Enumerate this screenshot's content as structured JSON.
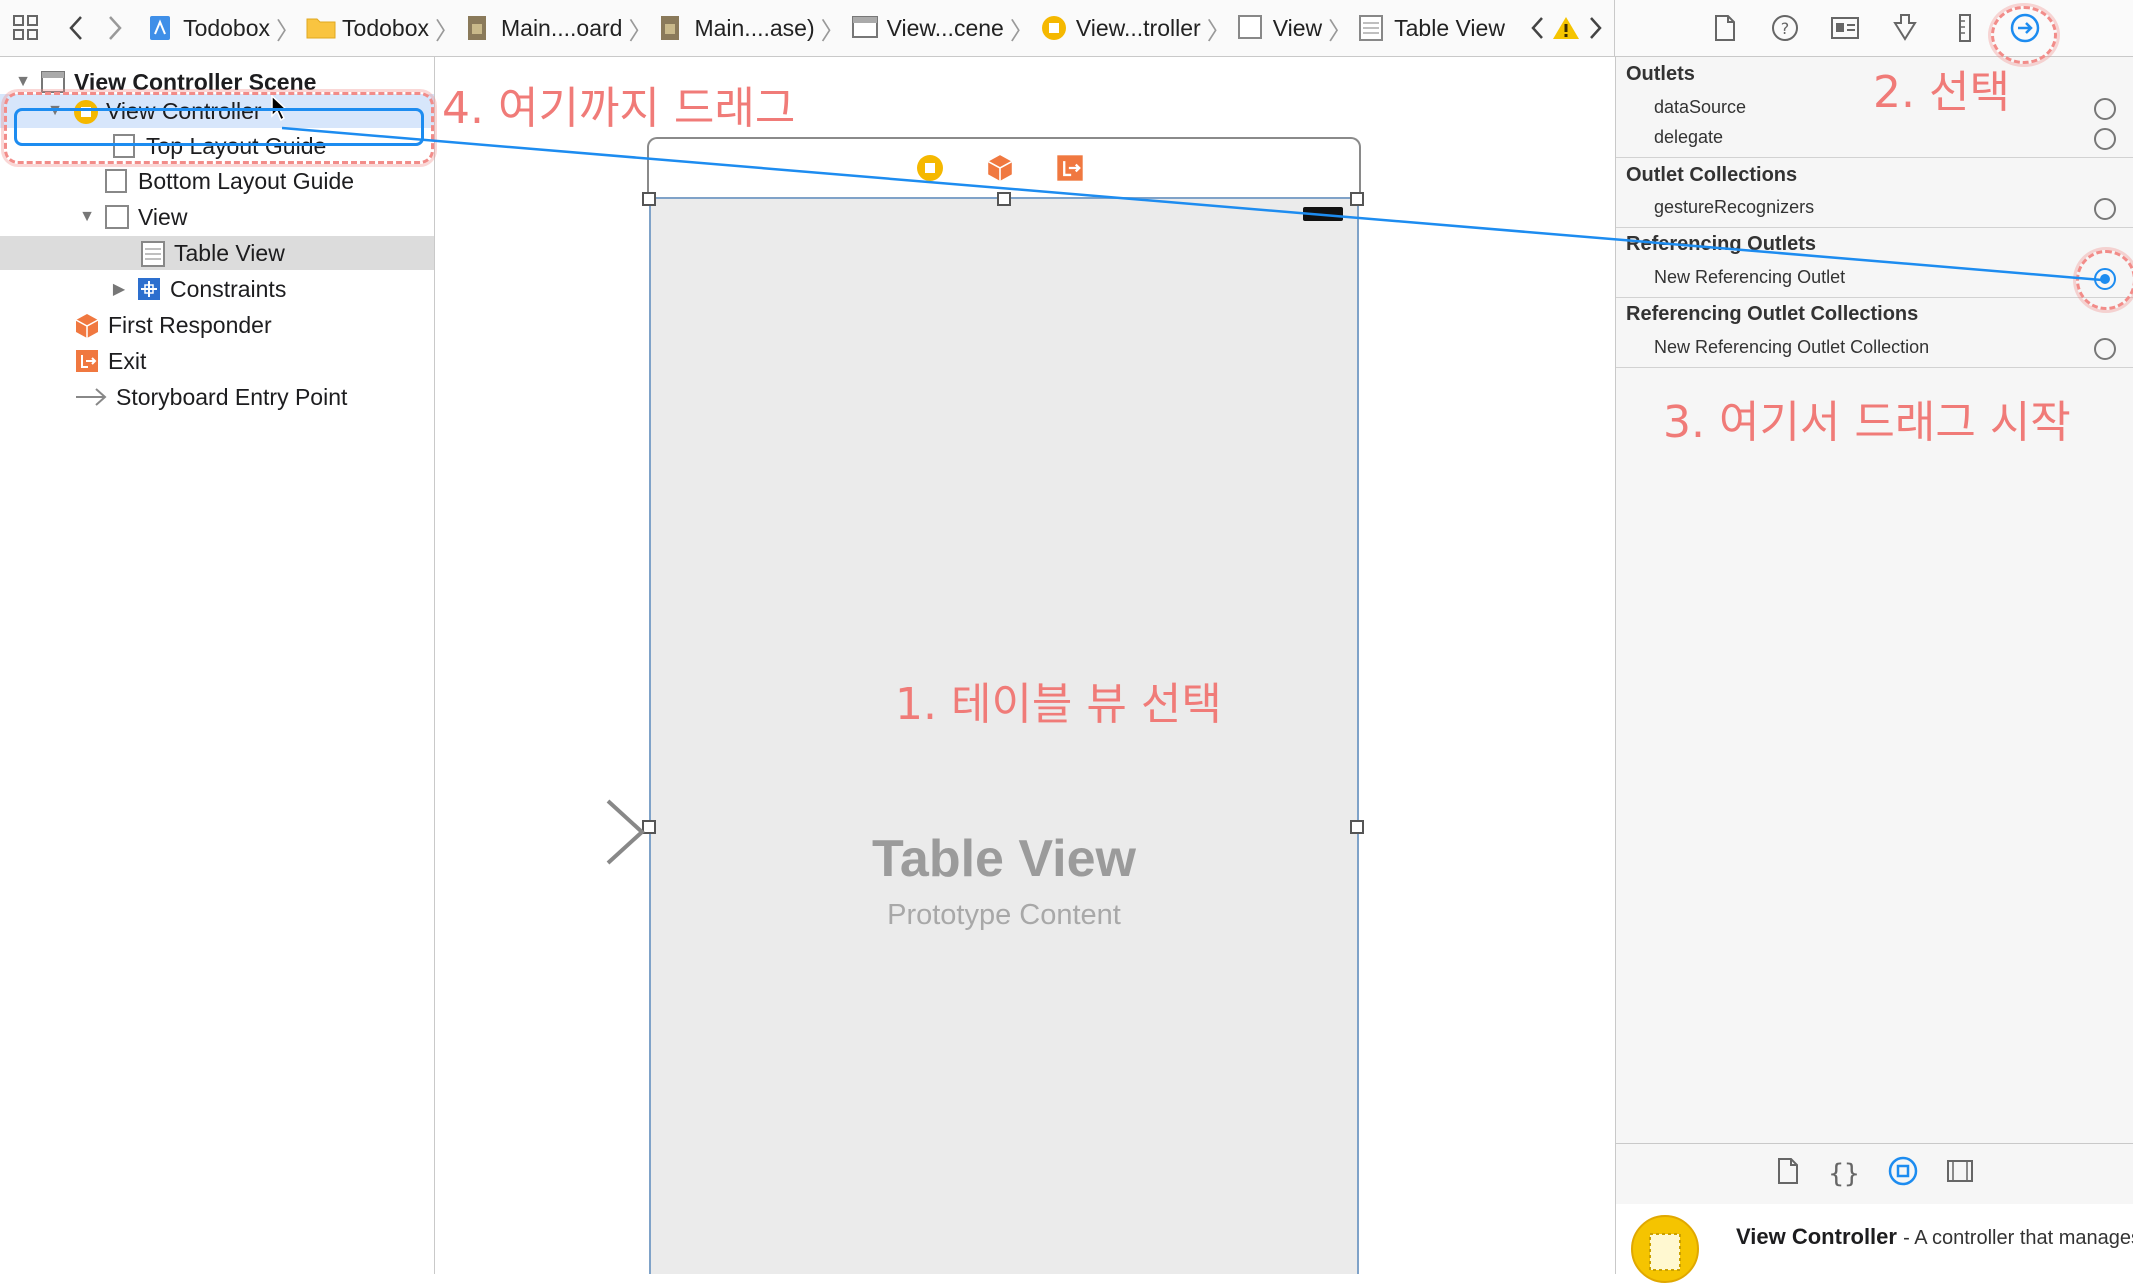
{
  "jumpbar": {
    "crumbs": [
      {
        "label": "Todobox",
        "icon": "project-icon"
      },
      {
        "label": "Todobox",
        "icon": "folder-icon"
      },
      {
        "label": "Main....oard",
        "icon": "storyboard-icon"
      },
      {
        "label": "Main....ase)",
        "icon": "storyboard-icon"
      },
      {
        "label": "View...cene",
        "icon": "scene-icon"
      },
      {
        "label": "View...troller",
        "icon": "view-controller-icon"
      },
      {
        "label": "View",
        "icon": "view-icon"
      },
      {
        "label": "Table View",
        "icon": "table-view-icon"
      }
    ]
  },
  "outline": {
    "scene_label": "View Controller Scene",
    "items": [
      {
        "label": "View Controller"
      },
      {
        "label": "Top Layout Guide"
      },
      {
        "label": "Bottom Layout Guide"
      },
      {
        "label": "View"
      },
      {
        "label": "Table View"
      },
      {
        "label": "Constraints"
      },
      {
        "label": "First Responder"
      },
      {
        "label": "Exit"
      },
      {
        "label": "Storyboard Entry Point"
      }
    ]
  },
  "canvas": {
    "table_title": "Table View",
    "table_subtitle": "Prototype Content"
  },
  "inspector": {
    "outlets_header": "Outlets",
    "outlets": [
      "dataSource",
      "delegate"
    ],
    "collections_header": "Outlet Collections",
    "collections": [
      "gestureRecognizers"
    ],
    "ref_header": "Referencing Outlets",
    "ref_item": "New Referencing Outlet",
    "ref_coll_header": "Referencing Outlet Collections",
    "ref_coll_item": "New Referencing Outlet Collection",
    "library_title": "View Controller",
    "library_desc": "- A controller that manages a view."
  },
  "annotations": {
    "step1": "1. 테이블 뷰 선택",
    "step2": "2. 선택",
    "step3": "3. 여기서 드래그 시작",
    "step4": "4. 여기까지 드래그"
  },
  "colors": {
    "accent": "#1d8cf0",
    "annotation": "#f07b78",
    "warning": "#f5c400",
    "vc_yellow": "#f5b800",
    "orange": "#f07840"
  }
}
